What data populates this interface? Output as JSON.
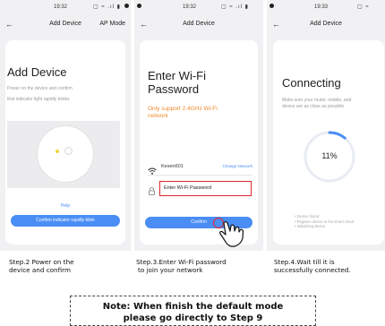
{
  "screen1": {
    "time": "19:32",
    "status_icons": "▢ ≈ .ıl ▮",
    "back": "←",
    "title": "Add Device",
    "mode": "AP Mode",
    "heading": "Add Device",
    "desc1": "Power on the device and confirm",
    "desc2": "that indicator light rapidly blinks",
    "help": "Help",
    "confirm_btn": "Confirm indicator rapidly blink"
  },
  "screen2": {
    "time": "19:32",
    "status_icons": "▢ ≈ .ıl ▮",
    "back": "←",
    "title": "Add Device",
    "heading_line1": "Enter Wi-Fi",
    "heading_line2": "Password",
    "warn_line1": "Only support 2.4GHz Wi-Fi",
    "warn_line2": "network",
    "wifi_name": "Kesen601",
    "change_network": "Change Network",
    "password_placeholder": "Enter Wi-Fi Password",
    "confirm_btn": "Confirm"
  },
  "screen3": {
    "time": "19:33",
    "status_icons": "▢ ≈",
    "back": "←",
    "title": "Add Device",
    "heading": "Connecting",
    "desc1": "Make sure your router, mobile, and",
    "desc2": "device are as close as possible",
    "progress_label": "11%",
    "progress": 0.11,
    "step1": "Device found",
    "step2": "Register device to the smart cloud",
    "step3": "Initializing device"
  },
  "captions": {
    "c1_line1": "Step.2 Power on the",
    "c1_line2": "device and confirm",
    "c2_line1": "Step.3.Enter Wi-Fi password",
    "c2_line2": "to join your network",
    "c3_line1": "Step.4.Wait till it is",
    "c3_line2": "successfully connected."
  },
  "note": {
    "line1": "Note: When finish the default mode",
    "line2": "please go directly to Step 9"
  },
  "colors": {
    "accent": "#4a8ef5",
    "warning": "#f08a2c",
    "highlight": "#e0262a"
  }
}
